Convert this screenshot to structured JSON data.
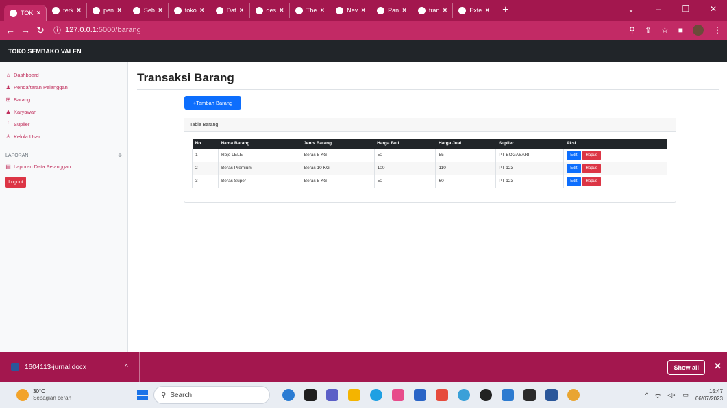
{
  "browser": {
    "tabs": [
      {
        "label": "TOK",
        "icon": "globe-icon"
      },
      {
        "label": "terk",
        "icon": "google-icon"
      },
      {
        "label": "pen",
        "icon": "graduation-cap-icon"
      },
      {
        "label": "Seb",
        "icon": "globe-icon"
      },
      {
        "label": "toko",
        "icon": "google-icon"
      },
      {
        "label": "Dat",
        "icon": "google-icon"
      },
      {
        "label": "des",
        "icon": "google-icon"
      },
      {
        "label": "The",
        "icon": "image-icon"
      },
      {
        "label": "Nev",
        "icon": "globe-icon"
      },
      {
        "label": "Pan",
        "icon": "document-icon"
      },
      {
        "label": "tran",
        "icon": "google-icon"
      },
      {
        "label": "Exte",
        "icon": "puzzle-icon"
      }
    ],
    "new_tab_glyph": "+",
    "url_host": "127.0.0.1",
    "url_path": ":5000/barang",
    "info_glyph": "ⓘ"
  },
  "app": {
    "brand": "TOKO SEMBAKO VALEN"
  },
  "sidebar": {
    "items": [
      {
        "label": "Dashboard",
        "icon": "home-icon",
        "glyph": "⌂"
      },
      {
        "label": "Pendaftaran Pelanggan",
        "icon": "users-icon",
        "glyph": "♟"
      },
      {
        "label": "Barang",
        "icon": "cart-icon",
        "glyph": "⊞"
      },
      {
        "label": "Karyawan",
        "icon": "users-icon",
        "glyph": "♟"
      },
      {
        "label": "Suplier",
        "icon": "chart-icon",
        "glyph": "⫶"
      },
      {
        "label": "Kelola User",
        "icon": "user-icon",
        "glyph": "♙"
      }
    ],
    "section_heading": "LAPORAN",
    "section_toggle": "⊕",
    "report_items": [
      {
        "label": "Laporan Data Pelanggan",
        "icon": "file-icon",
        "glyph": "▤"
      }
    ],
    "logout_label": "Logout"
  },
  "main": {
    "title": "Transaksi Barang",
    "add_button": "+Tambah Barang",
    "card_title": "Table Barang",
    "columns": [
      "No.",
      "Nama Barang",
      "Jenis Barang",
      "Harga Beli",
      "Harga Jual",
      "Suplier",
      "Aksi"
    ],
    "rows": [
      {
        "no": "1",
        "nama": "Rojo LELE",
        "jenis": "Beras 5 KG",
        "beli": "50",
        "jual": "55",
        "suplier": "PT BOGASARI"
      },
      {
        "no": "2",
        "nama": "Beras Premium",
        "jenis": "Beras 10 KG",
        "beli": "100",
        "jual": "110",
        "suplier": "PT 123"
      },
      {
        "no": "3",
        "nama": "Beras Super",
        "jenis": "Beras 5 KG",
        "beli": "50",
        "jual": "60",
        "suplier": "PT 123"
      }
    ],
    "edit_label": "Edit",
    "delete_label": "Hapus"
  },
  "download": {
    "filename": "1604113-jurnal.docx",
    "show_all": "Show all"
  },
  "taskbar": {
    "temperature": "30°C",
    "condition": "Sebagian cerah",
    "search_placeholder": "Search",
    "time": "15:47",
    "date": "06/07/2023"
  },
  "colors": {
    "chrome": "#a3174e",
    "accent": "#0d6efd",
    "danger": "#dc3545",
    "nav": "#212529"
  }
}
